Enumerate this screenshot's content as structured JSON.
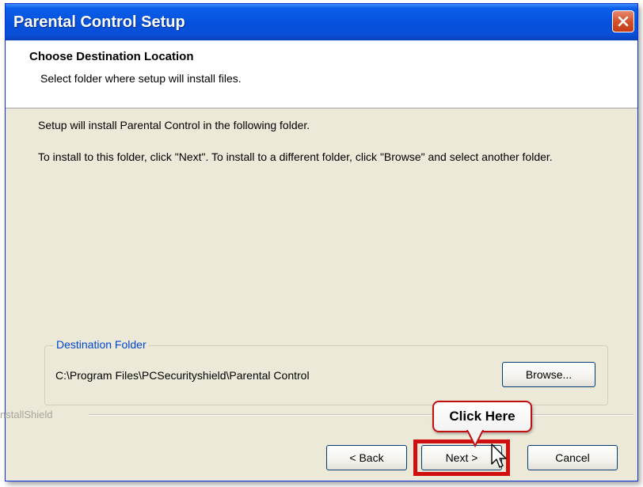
{
  "window": {
    "title": "Parental Control Setup",
    "close_icon": "close-icon"
  },
  "header": {
    "title": "Choose Destination Location",
    "subtitle": "Select folder where setup will install files."
  },
  "body": {
    "line1": "Setup will install Parental Control in the following folder.",
    "line2": "To install to this folder, click \"Next\". To install to a different folder, click \"Browse\" and select another folder."
  },
  "destination": {
    "legend": "Destination Folder",
    "path": "C:\\Program Files\\PCSecurityshield\\Parental Control",
    "browse_label": "Browse..."
  },
  "footer": {
    "brand": "nstallShield",
    "back_label": "< Back",
    "next_label": "Next >",
    "cancel_label": "Cancel"
  },
  "annotation": {
    "callout_text": "Click Here",
    "highlight_color": "#d01010"
  }
}
